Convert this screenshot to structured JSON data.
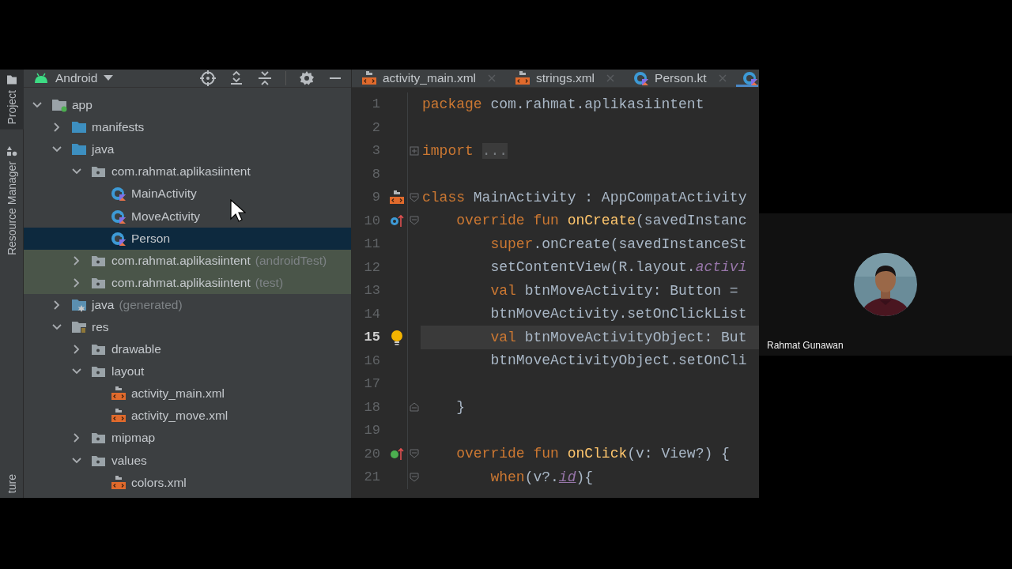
{
  "left_strip": {
    "tabs": [
      {
        "label": "Project",
        "kind": "project",
        "selected": true
      },
      {
        "label": "Resource Manager",
        "kind": "resource",
        "selected": false
      }
    ],
    "bottom_tabs": [
      {
        "label": "ture",
        "selected": false
      }
    ]
  },
  "project_panel": {
    "view": {
      "label": "Android"
    },
    "tree": [
      {
        "label": "app",
        "kind": "module",
        "expanded": true,
        "selected": false,
        "children": [
          {
            "label": "manifests",
            "kind": "folder",
            "expanded": false,
            "selected": false
          },
          {
            "label": "java",
            "kind": "folder",
            "expanded": true,
            "selected": false,
            "children": [
              {
                "label": "com.rahmat.aplikasiintent",
                "kind": "package",
                "expanded": true,
                "selected": false,
                "children": [
                  {
                    "label": "MainActivity",
                    "kind": "kotlin-class",
                    "selected": false
                  },
                  {
                    "label": "MoveActivity",
                    "kind": "kotlin-class",
                    "selected": false
                  },
                  {
                    "label": "Person",
                    "kind": "kotlin-class",
                    "selected": true
                  }
                ]
              },
              {
                "label": "com.rahmat.aplikasiintent",
                "note": "(androidTest)",
                "kind": "test-package",
                "expanded": false,
                "selected": false
              },
              {
                "label": "com.rahmat.aplikasiintent",
                "note": "(test)",
                "kind": "test-package",
                "expanded": false,
                "selected": false
              }
            ]
          },
          {
            "label": "java",
            "note": "(generated)",
            "kind": "generated-folder",
            "expanded": false,
            "selected": false
          },
          {
            "label": "res",
            "kind": "res-folder",
            "expanded": true,
            "selected": false,
            "children": [
              {
                "label": "drawable",
                "kind": "res-dir",
                "expanded": false,
                "selected": false
              },
              {
                "label": "layout",
                "kind": "res-dir",
                "expanded": true,
                "selected": false,
                "children": [
                  {
                    "label": "activity_main.xml",
                    "kind": "xml",
                    "selected": false
                  },
                  {
                    "label": "activity_move.xml",
                    "kind": "xml",
                    "selected": false
                  }
                ]
              },
              {
                "label": "mipmap",
                "kind": "res-dir",
                "expanded": false,
                "selected": false
              },
              {
                "label": "values",
                "kind": "res-dir",
                "expanded": true,
                "selected": false,
                "children": [
                  {
                    "label": "colors.xml",
                    "kind": "xml",
                    "selected": false
                  }
                ]
              }
            ]
          }
        ]
      }
    ]
  },
  "editor": {
    "tabs": [
      {
        "label": "activity_main.xml",
        "kind": "xml",
        "selected": false
      },
      {
        "label": "strings.xml",
        "kind": "xml",
        "selected": false
      },
      {
        "label": "Person.kt",
        "kind": "kotlin",
        "selected": false
      },
      {
        "kind": "kotlin",
        "selected": true
      }
    ],
    "lines": [
      {
        "number": "1",
        "current": false,
        "tokens": [
          {
            "kind": "keyword",
            "text": "package"
          },
          {
            "kind": "plain",
            "text": " com.rahmat.aplikasiintent"
          }
        ]
      },
      {
        "number": "2",
        "current": false
      },
      {
        "number": "3",
        "current": false,
        "fold": {
          "kind": "collapsed"
        },
        "tokens": [
          {
            "kind": "keyword",
            "text": "import "
          },
          {
            "kind": "folded",
            "text": "..."
          }
        ]
      },
      {
        "number": "8",
        "current": false
      },
      {
        "number": "9",
        "current": false,
        "gutter": {
          "kind": "layout"
        },
        "fold": {
          "kind": "start"
        },
        "tokens": [
          {
            "kind": "keyword",
            "text": "class"
          },
          {
            "kind": "plain",
            "text": " MainActivity : AppCompatActivity"
          }
        ]
      },
      {
        "number": "10",
        "current": false,
        "gutter": {
          "kind": "override"
        },
        "fold": {
          "kind": "start"
        },
        "tokens": [
          {
            "kind": "keyword",
            "text": "    override fun"
          },
          {
            "kind": "function",
            "text": " onCreate"
          },
          {
            "kind": "plain",
            "text": "(savedInstanc"
          }
        ]
      },
      {
        "number": "11",
        "current": false,
        "tokens": [
          {
            "kind": "keyword",
            "text": "        super"
          },
          {
            "kind": "plain",
            "text": ".onCreate(savedInstanceSt"
          }
        ]
      },
      {
        "number": "12",
        "current": false,
        "tokens": [
          {
            "kind": "plain",
            "text": "        setContentView(R.layout."
          },
          {
            "kind": "field",
            "text": "activi"
          }
        ]
      },
      {
        "number": "13",
        "current": false,
        "tokens": [
          {
            "kind": "keyword",
            "text": "        val"
          },
          {
            "kind": "plain",
            "text": " btnMoveActivity: Button ="
          }
        ]
      },
      {
        "number": "14",
        "current": false,
        "tokens": [
          {
            "kind": "plain",
            "text": "        btnMoveActivity.setOnClickList"
          }
        ]
      },
      {
        "number": "15",
        "current": true,
        "gutter": {
          "kind": "bulb"
        },
        "tokens": [
          {
            "kind": "keyword",
            "text": "        val"
          },
          {
            "kind": "plain",
            "text": " btnMoveActivityObject: But"
          }
        ]
      },
      {
        "number": "16",
        "current": false,
        "tokens": [
          {
            "kind": "plain",
            "text": "        btnMoveActivityObject.setOnCli"
          }
        ]
      },
      {
        "number": "17",
        "current": false
      },
      {
        "number": "18",
        "current": false,
        "fold": {
          "kind": "end"
        },
        "tokens": [
          {
            "kind": "plain",
            "text": "    }"
          }
        ]
      },
      {
        "number": "19",
        "current": false
      },
      {
        "number": "20",
        "current": false,
        "gutter": {
          "kind": "implement"
        },
        "fold": {
          "kind": "start"
        },
        "tokens": [
          {
            "kind": "keyword",
            "text": "    override fun"
          },
          {
            "kind": "function",
            "text": " onClick"
          },
          {
            "kind": "plain",
            "text": "(v: View?) {"
          }
        ]
      },
      {
        "number": "21",
        "current": false,
        "fold": {
          "kind": "start"
        },
        "tokens": [
          {
            "kind": "keyword",
            "text": "        when"
          },
          {
            "kind": "plain",
            "text": "(v?."
          },
          {
            "kind": "field-link",
            "text": "id"
          },
          {
            "kind": "plain",
            "text": "){"
          }
        ]
      }
    ]
  },
  "participant": {
    "name": "Rahmat Gunawan"
  }
}
